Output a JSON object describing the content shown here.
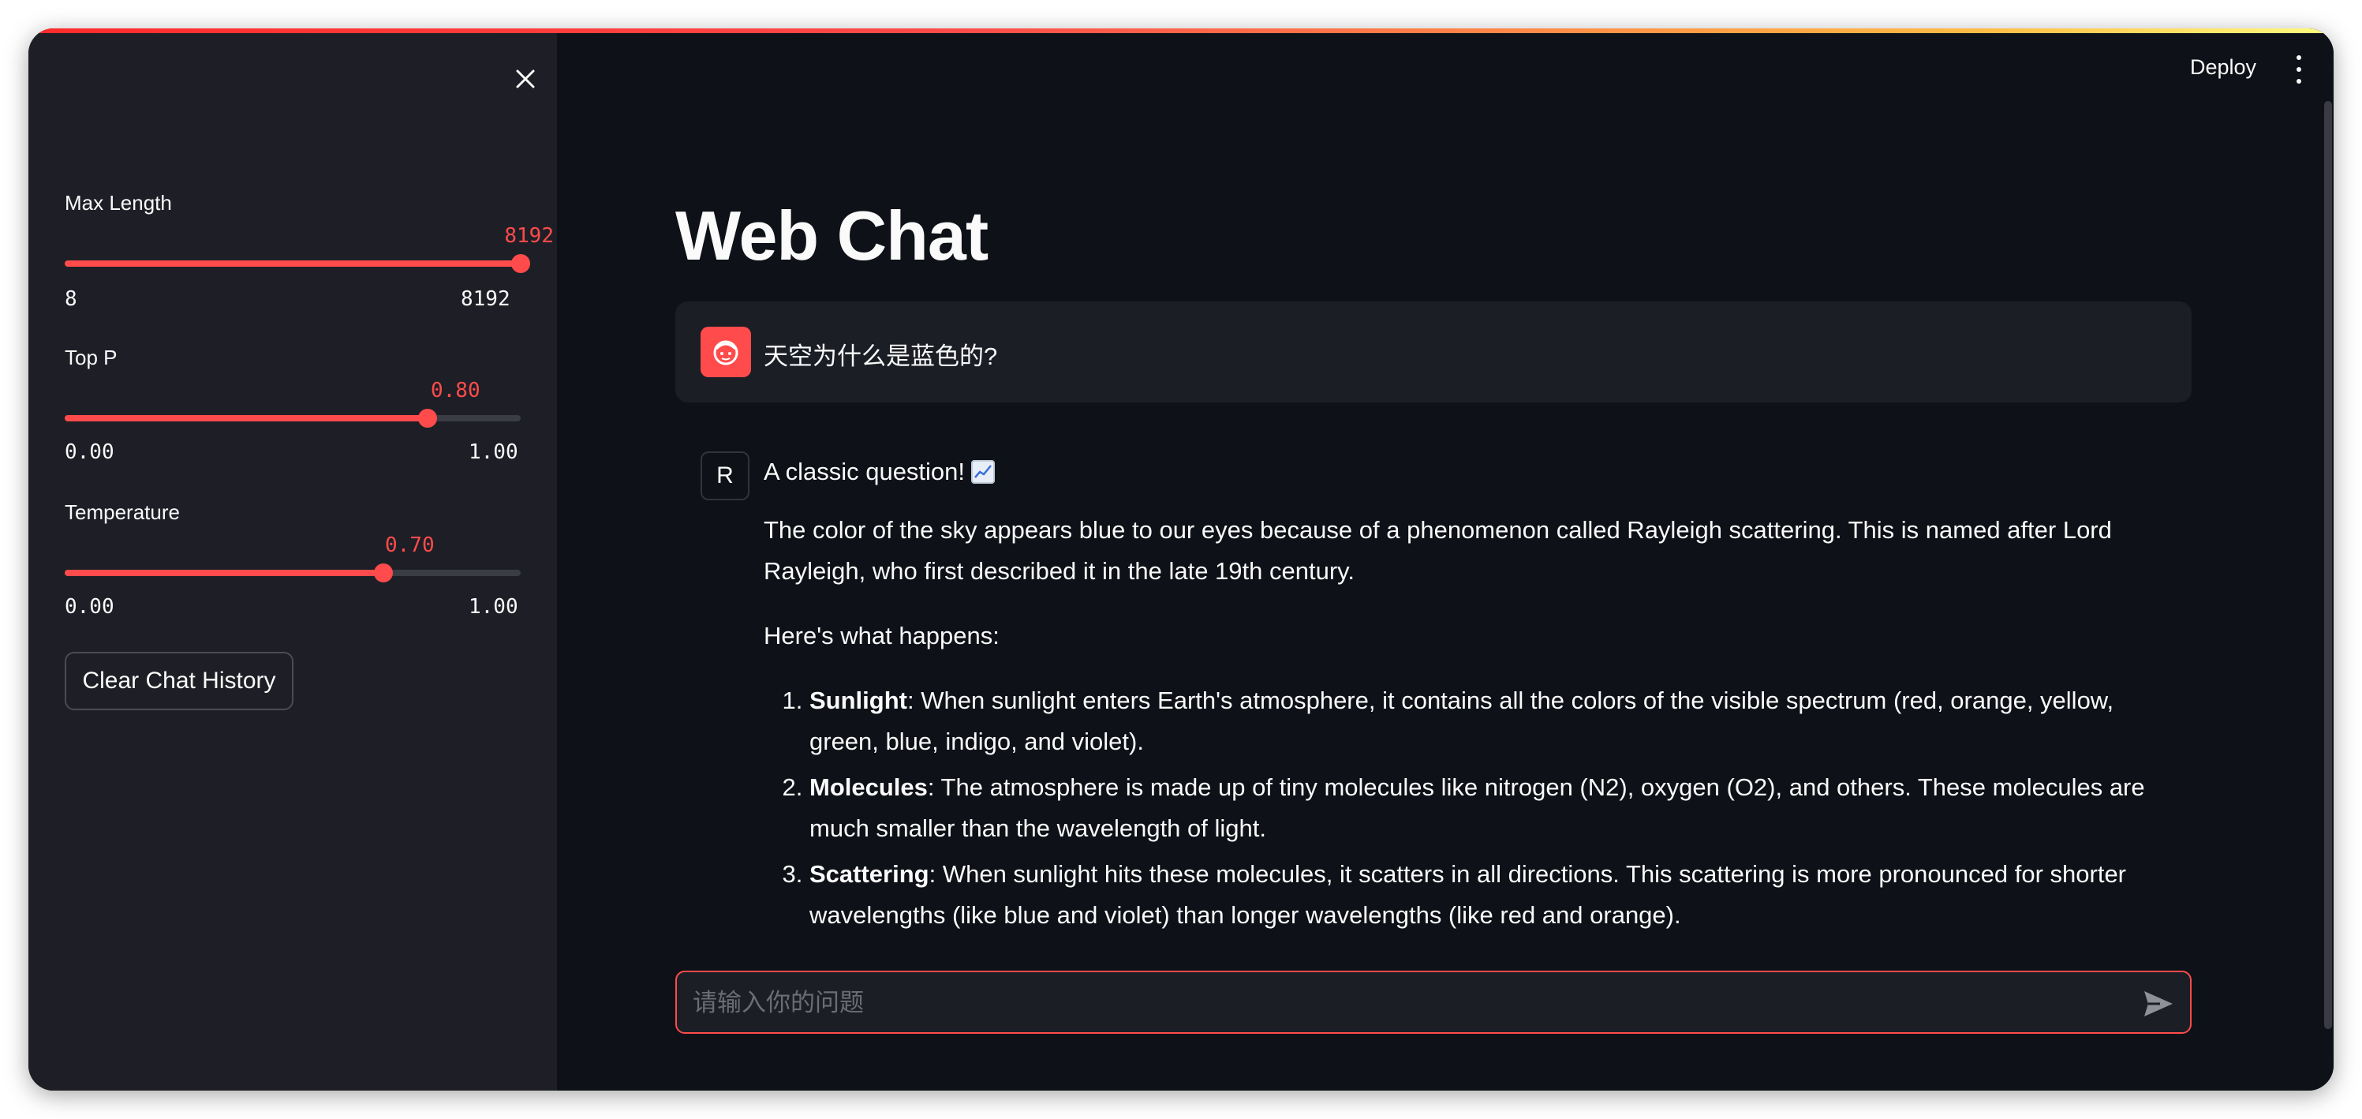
{
  "header": {
    "deploy_label": "Deploy"
  },
  "sidebar": {
    "sliders": [
      {
        "label": "Max Length",
        "value": "8192",
        "min": "8",
        "max": "8192",
        "fraction": 1.0
      },
      {
        "label": "Top P",
        "value": "0.80",
        "min": "0.00",
        "max": "1.00",
        "fraction": 0.8
      },
      {
        "label": "Temperature",
        "value": "0.70",
        "min": "0.00",
        "max": "1.00",
        "fraction": 0.7
      }
    ],
    "clear_label": "Clear Chat History"
  },
  "main": {
    "title": "Web Chat",
    "user_message": "天空为什么是蓝色的?",
    "assistant": {
      "avatar_letter": "R",
      "intro": "A classic question!",
      "intro_icon": "chart-increasing-icon",
      "para1": "The color of the sky appears blue to our eyes because of a phenomenon called Rayleigh scattering. This is named after Lord Rayleigh, who first described it in the late 19th century.",
      "para2": "Here's what happens:",
      "list": [
        {
          "term": "Sunlight",
          "text": ": When sunlight enters Earth's atmosphere, it contains all the colors of the visible spectrum (red, orange, yellow, green, blue, indigo, and violet)."
        },
        {
          "term": "Molecules",
          "text": ": The atmosphere is made up of tiny molecules like nitrogen (N2), oxygen (O2), and others. These molecules are much smaller than the wavelength of light."
        },
        {
          "term": "Scattering",
          "text": ": When sunlight hits these molecules, it scatters in all directions. This scattering is more pronounced for shorter wavelengths (like blue and violet) than longer wavelengths (like red and orange)."
        }
      ]
    },
    "input": {
      "placeholder": "请输入你的问题",
      "value": ""
    }
  },
  "colors": {
    "accent": "#ff4b4b",
    "sidebar_bg": "#1e1f26",
    "main_bg": "#0e1117"
  }
}
